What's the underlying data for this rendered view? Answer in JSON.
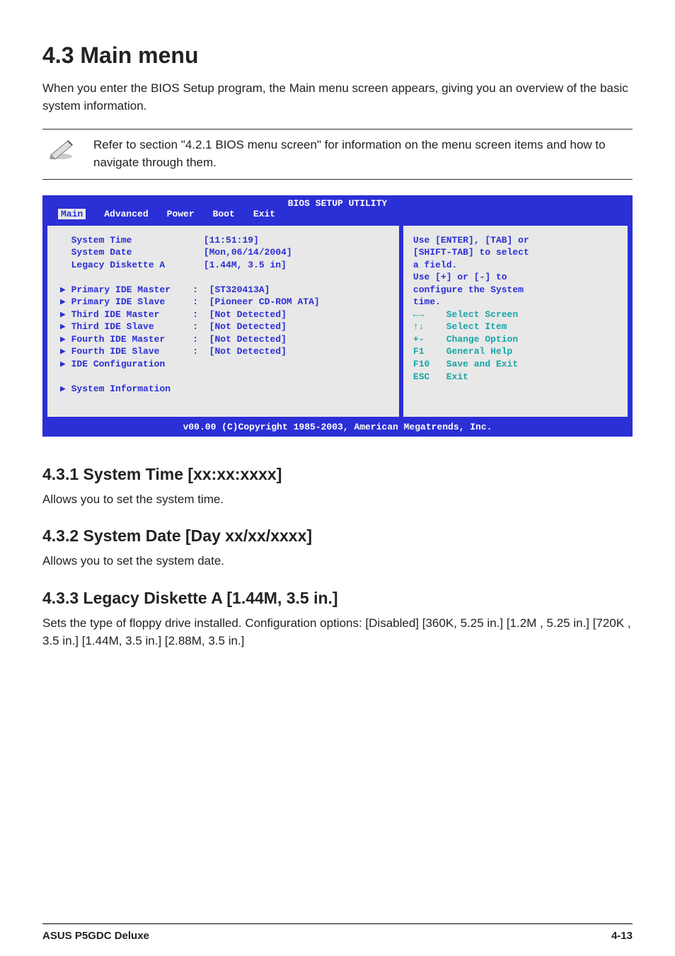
{
  "title": "4.3    Main menu",
  "intro": "When you enter the BIOS Setup program, the Main menu screen appears, giving you an overview of the basic system information.",
  "note": "Refer to section \"4.2.1  BIOS menu screen\" for information on the menu screen items and how to navigate through them.",
  "bios": {
    "header": "BIOS SETUP UTILITY",
    "menus": [
      "Main",
      "Advanced",
      "Power",
      "Boot",
      "Exit"
    ],
    "selected_menu": "Main",
    "left": {
      "system_time_label": "System Time",
      "system_time_value": "[11:51:19]",
      "system_date_label": "System Date",
      "system_date_value": "[Mon,06/14/2004]",
      "legacy_label": "Legacy Diskette A",
      "legacy_value": "[1.44M, 3.5 in]",
      "rows": [
        {
          "label": "Primary IDE Master",
          "value": "[ST320413A]"
        },
        {
          "label": "Primary IDE Slave",
          "value": "[Pioneer CD-ROM ATA]"
        },
        {
          "label": "Third IDE Master",
          "value": "[Not Detected]"
        },
        {
          "label": "Third IDE Slave",
          "value": "[Not Detected]"
        },
        {
          "label": "Fourth IDE Master",
          "value": "[Not Detected]"
        },
        {
          "label": "Fourth IDE Slave",
          "value": "[Not Detected]"
        }
      ],
      "ide_config": "IDE Configuration",
      "sys_info": "System Information"
    },
    "right": {
      "tip1a": "Use [ENTER], [TAB] or",
      "tip1b": "[SHIFT-TAB] to select",
      "tip1c": "a field.",
      "tip2a": "Use [+] or [-] to",
      "tip2b": "configure the System",
      "tip2c": "time.",
      "keys": [
        {
          "k": "←→",
          "l": "Select Screen"
        },
        {
          "k": "↑↓",
          "l": "Select Item"
        },
        {
          "k": "+-",
          "l": "Change Option"
        },
        {
          "k": "F1",
          "l": "General Help"
        },
        {
          "k": "F10",
          "l": "Save and Exit"
        },
        {
          "k": "ESC",
          "l": "Exit"
        }
      ]
    },
    "footer": "v00.00 (C)Copyright 1985-2003, American Megatrends, Inc."
  },
  "s431_title": "4.3.1   System Time [xx:xx:xxxx]",
  "s431_text": "Allows you to set the system time.",
  "s432_title": "4.3.2   System Date [Day xx/xx/xxxx]",
  "s432_text": "Allows you to set the system date.",
  "s433_title": "4.3.3   Legacy Diskette A [1.44M, 3.5 in.]",
  "s433_text": "Sets the type of floppy drive installed. Configuration options: [Disabled] [360K, 5.25 in.] [1.2M , 5.25 in.] [720K , 3.5 in.] [1.44M, 3.5 in.] [2.88M, 3.5 in.]",
  "footer_left": "ASUS P5GDC Deluxe",
  "footer_right": "4-13"
}
